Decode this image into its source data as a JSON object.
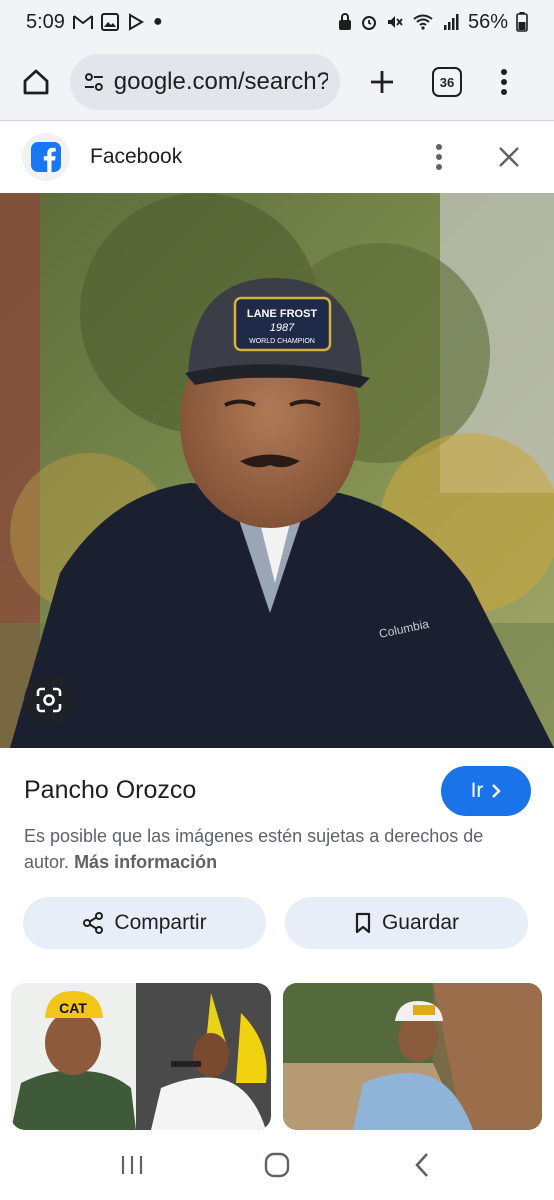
{
  "status_bar": {
    "time": "5:09",
    "battery": "56%"
  },
  "browser": {
    "url": "google.com/search?",
    "tab_count": "36"
  },
  "source": {
    "name": "Facebook"
  },
  "result": {
    "title": "Pancho Orozco",
    "visit_label": "Ir",
    "copyright_text": "Es posible que las imágenes estén sujetas a derechos de autor.",
    "more_info_label": "Más información",
    "share_label": "Compartir",
    "save_label": "Guardar"
  },
  "image": {
    "cap_line1": "LANE FROST",
    "cap_line2": "1987",
    "cap_line3": "WORLD CHAMPION",
    "jacket_brand": "Columbia"
  },
  "related": {
    "thumb1_cap_text": "CAT"
  },
  "colors": {
    "accent": "#1a73e8",
    "facebook": "#1877f2",
    "chrome_bg": "#f1f3f6",
    "action_btn_bg": "#e8eef8"
  }
}
